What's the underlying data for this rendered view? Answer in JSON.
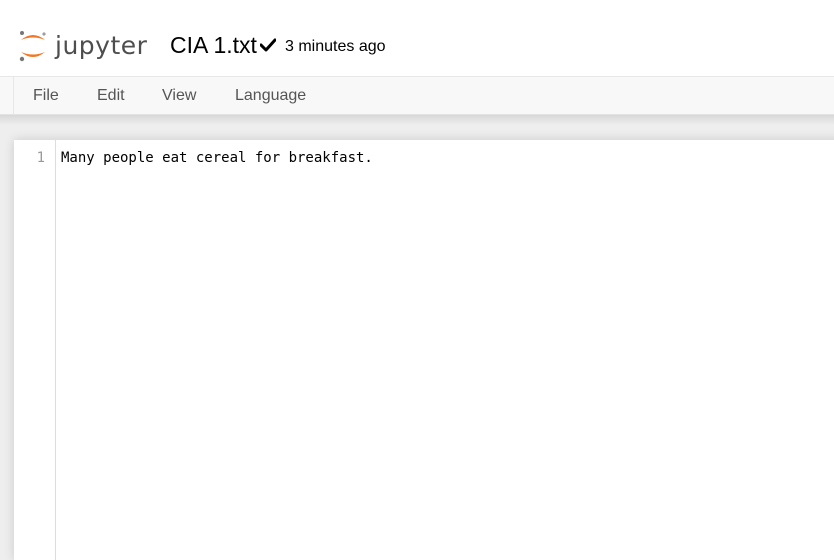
{
  "header": {
    "logo_text": "jupyter",
    "notebook_name": "CIA 1.txt",
    "save_status": "3 minutes ago",
    "logo_colors": {
      "orange": "#f37726",
      "gray": "#767677"
    }
  },
  "menubar": {
    "items": [
      {
        "label": "File"
      },
      {
        "label": "Edit"
      },
      {
        "label": "View"
      },
      {
        "label": "Language"
      }
    ]
  },
  "editor": {
    "lines": [
      {
        "number": "1",
        "text": "Many people eat cereal for breakfast."
      }
    ]
  }
}
